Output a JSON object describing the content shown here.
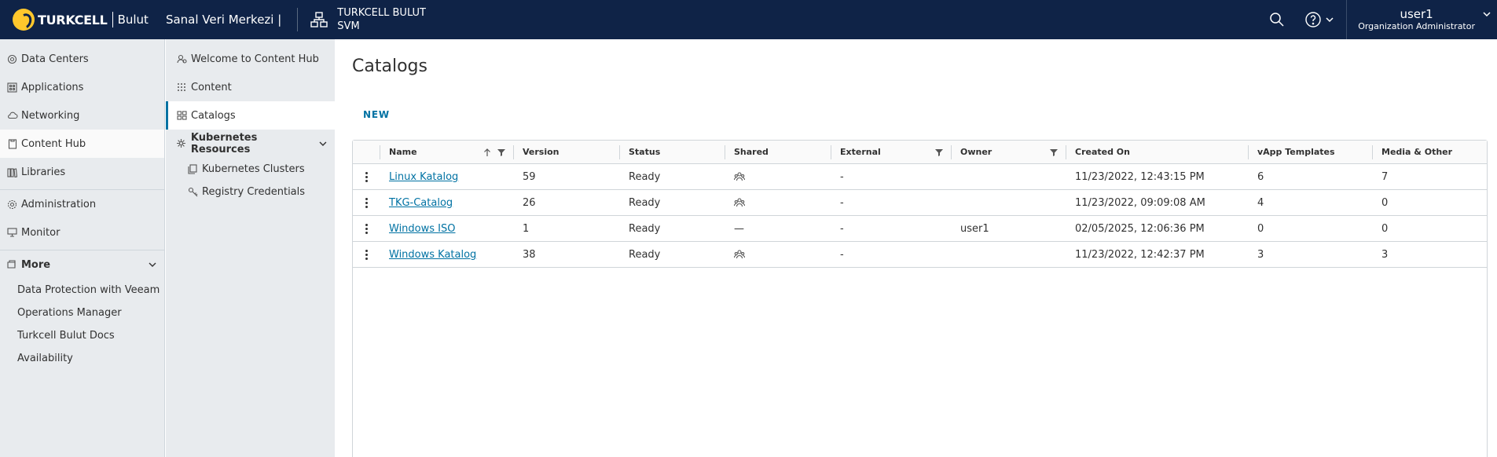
{
  "header": {
    "brand": "TURKCELL",
    "product": "Bulut",
    "site": "Sanal Veri Merkezi |",
    "org_line1": "TURKCELL BULUT",
    "org_line2": "SVM",
    "user_name": "user1",
    "user_role": "Organization Administrator"
  },
  "nav": {
    "items": [
      {
        "label": "Data Centers",
        "icon": "datacenter-icon"
      },
      {
        "label": "Applications",
        "icon": "applications-icon"
      },
      {
        "label": "Networking",
        "icon": "cloud-network-icon"
      },
      {
        "label": "Content Hub",
        "icon": "content-hub-icon"
      },
      {
        "label": "Libraries",
        "icon": "libraries-icon"
      },
      {
        "label": "Administration",
        "icon": "gear-icon"
      },
      {
        "label": "Monitor",
        "icon": "monitor-icon"
      }
    ],
    "more_label": "More",
    "more_items": [
      "Data Protection with Veeam",
      "Operations Manager",
      "Turkcell Bulut Docs",
      "Availability"
    ]
  },
  "subnav": {
    "items": [
      "Welcome to Content Hub",
      "Content",
      "Catalogs"
    ],
    "group_label": "Kubernetes Resources",
    "group_items": [
      "Kubernetes Clusters",
      "Registry Credentials"
    ]
  },
  "main": {
    "title": "Catalogs",
    "new_label": "NEW",
    "columns": [
      "Name",
      "Version",
      "Status",
      "Shared",
      "External",
      "Owner",
      "Created On",
      "vApp Templates",
      "Media & Other"
    ],
    "rows": [
      {
        "name": "Linux Katalog",
        "version": "59",
        "status": "Ready",
        "shared": "shared-group-icon",
        "external": "-",
        "owner": "",
        "created": "11/23/2022, 12:43:15 PM",
        "vapp": "6",
        "media": "7"
      },
      {
        "name": "TKG-Catalog",
        "version": "26",
        "status": "Ready",
        "shared": "shared-group-icon",
        "external": "-",
        "owner": "",
        "created": "11/23/2022, 09:09:08 AM",
        "vapp": "4",
        "media": "0"
      },
      {
        "name": "Windows ISO",
        "version": "1",
        "status": "Ready",
        "shared": "—",
        "external": "-",
        "owner": "user1",
        "created": "02/05/2025, 12:06:36 PM",
        "vapp": "0",
        "media": "0"
      },
      {
        "name": "Windows Katalog",
        "version": "38",
        "status": "Ready",
        "shared": "shared-group-icon",
        "external": "-",
        "owner": "",
        "created": "11/23/2022, 12:42:37 PM",
        "vapp": "3",
        "media": "3"
      }
    ]
  },
  "colors": {
    "header_bg": "#0f2347",
    "nav_bg": "#e8ebee",
    "link": "#0072a3",
    "brand_yellow": "#ffc72c"
  }
}
